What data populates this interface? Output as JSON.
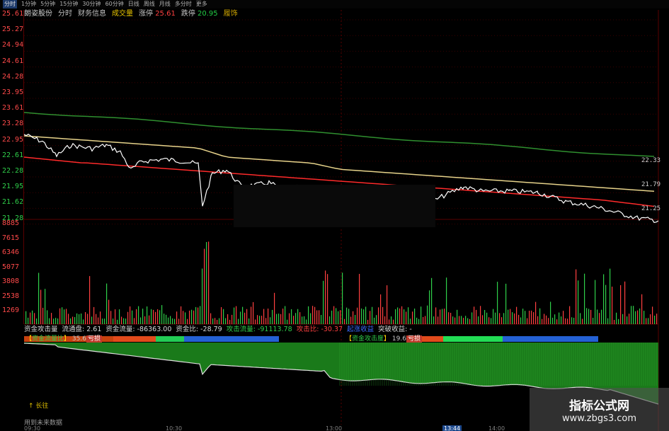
{
  "toolbar": {
    "items": [
      "分时",
      "1分钟",
      "5分钟",
      "15分钟",
      "30分钟",
      "60分钟",
      "日线",
      "周线",
      "月线",
      "多分时",
      "更多"
    ]
  },
  "title_bar": {
    "stock": "朗姿股份",
    "tabs": [
      "分时",
      "财务信息",
      "成交量"
    ],
    "limit_up_label": "涨停",
    "limit_up_value": "25.61",
    "limit_down_label": "跌停",
    "limit_down_value": "20.95",
    "fix_label": "履饰"
  },
  "price_axis": [
    "25.61",
    "25.27",
    "24.94",
    "24.61",
    "24.28",
    "23.95",
    "23.61",
    "23.28",
    "22.95",
    "22.61",
    "22.28",
    "21.95",
    "21.62",
    "21.28"
  ],
  "volume_axis": [
    "8885",
    "7615",
    "6346",
    "5077",
    "3808",
    "2538",
    "1269"
  ],
  "line_end_labels": [
    "22.33",
    "21.79",
    "21.25"
  ],
  "indicator_bar": {
    "items": [
      {
        "text": "资金攻击量",
        "color": "white"
      },
      {
        "text": "流通盘: 2.61",
        "color": "white"
      },
      {
        "text": "资金流量: -86363.00",
        "color": "white"
      },
      {
        "text": "资金比: -28.79",
        "color": "white"
      },
      {
        "text": "攻击流量: -91113.78",
        "color": "green"
      },
      {
        "text": "攻击比: -30.37",
        "color": "red"
      },
      {
        "text": "起涨收益",
        "color": "blue"
      },
      {
        "text": "突破收益: -",
        "color": "white"
      }
    ]
  },
  "legend_left": {
    "label_open": "【",
    "label_inner": "资金流量比",
    "label_close": "】",
    "value": "35.6",
    "tag": "亏损"
  },
  "legend_right": {
    "label_open": "【",
    "label_inner": "资金攻击度",
    "label_close": "】",
    "value": "19.6",
    "tag": "亏损"
  },
  "up_marker": "长往",
  "bottom_text": "用到未来数据",
  "time_labels": [
    {
      "text": "09:30",
      "hl": false
    },
    {
      "text": "10:30",
      "hl": false
    },
    {
      "text": "13:00",
      "hl": false
    },
    {
      "text": "13:44",
      "hl": true
    },
    {
      "text": "14:00",
      "hl": false
    }
  ],
  "watermark": {
    "title": "指标公式网",
    "url": "www.zbgs3.com"
  },
  "colors": {
    "up": "#ff4040",
    "down": "#2fcf4a",
    "price_line": "#ffffff",
    "avg_line": "#e6d28a",
    "ma_red": "#ff2a2a",
    "ma_green": "#2f8f2f"
  }
}
